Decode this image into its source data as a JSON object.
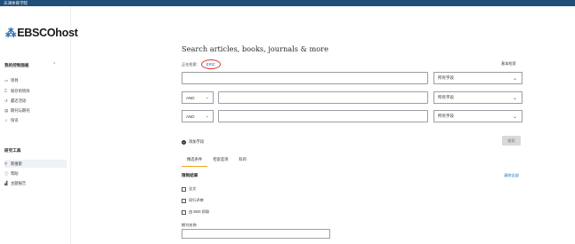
{
  "topbar": {
    "institution": "天津体育学院"
  },
  "sidebar": {
    "logo": "EBSCOhost",
    "my_dashboard": {
      "heading": "我的控制面板",
      "items": [
        {
          "label": "项目",
          "icon": "folder-icon"
        },
        {
          "label": "保存的项目",
          "icon": "bookmark-icon"
        },
        {
          "label": "最近活动",
          "icon": "history-icon"
        },
        {
          "label": "期刊与期刊",
          "icon": "journal-icon"
        },
        {
          "label": "快讯",
          "icon": "bell-icon"
        }
      ]
    },
    "research_tools": {
      "heading": "研究工具",
      "items": [
        {
          "label": "新搜索",
          "icon": "search-icon",
          "active": true
        },
        {
          "label": "帮助",
          "icon": "help-icon"
        },
        {
          "label": "主题报告",
          "icon": "report-icon"
        }
      ]
    }
  },
  "main": {
    "title": "Search articles, books, journals & more",
    "searching_label": "正在检索:",
    "database": "ERIC",
    "basic_search": "基本检索",
    "rows": [
      {
        "bool": "",
        "value": "",
        "field": "所有字段"
      },
      {
        "bool": "AND",
        "value": "",
        "field": "所有字段"
      },
      {
        "bool": "AND",
        "value": "",
        "field": "所有字段"
      }
    ],
    "add_field": "添加字段",
    "search_button": "搜索",
    "tabs": [
      "精选条件",
      "检索选项",
      "科目"
    ],
    "limit_heading": "限制结果",
    "clear_all": "清除全部",
    "checkboxes": [
      "全文",
      "同行评审",
      "由 EBS 抓取"
    ],
    "publication_label": "期刊名称",
    "publication_value": ""
  }
}
